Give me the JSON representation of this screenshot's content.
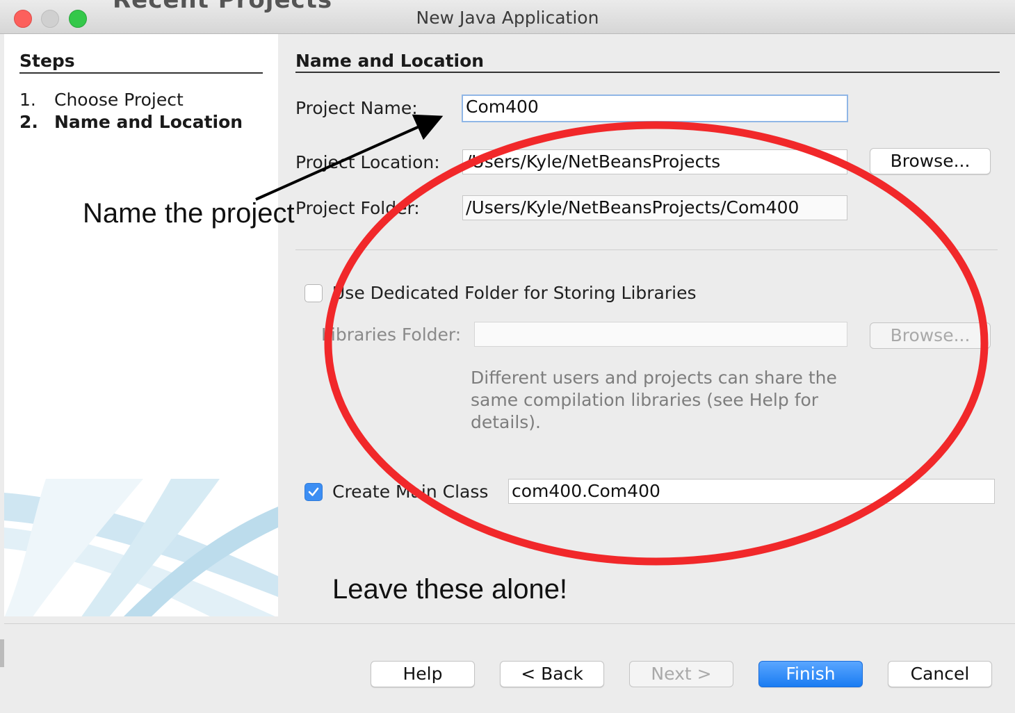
{
  "window": {
    "title": "New Java Application",
    "background_title_fragment": "Recent Projects"
  },
  "steps": {
    "title": "Steps",
    "items": [
      {
        "num": "1.",
        "label": "Choose Project"
      },
      {
        "num": "2.",
        "label": "Name and Location"
      }
    ]
  },
  "section": {
    "title": "Name and Location"
  },
  "form": {
    "project_name_label": "Project Name:",
    "project_name_value": "Com400",
    "project_location_label": "Project Location:",
    "project_location_value": "/Users/Kyle/NetBeansProjects",
    "browse_label": "Browse...",
    "project_folder_label": "Project Folder:",
    "project_folder_value": "/Users/Kyle/NetBeansProjects/Com400",
    "dedicated_folder_label": "Use Dedicated Folder for Storing Libraries",
    "dedicated_folder_checked": false,
    "libraries_folder_label": "Libraries Folder:",
    "libraries_folder_value": "",
    "libraries_browse_label": "Browse...",
    "help_text": "Different users and projects can share the same compilation libraries (see Help for details).",
    "create_main_label": "Create Main Class",
    "create_main_checked": true,
    "main_class_value": "com400.Com400"
  },
  "footer": {
    "help": "Help",
    "back": "< Back",
    "next": "Next >",
    "finish": "Finish",
    "cancel": "Cancel"
  },
  "annotations": {
    "name_project": "Name the project",
    "leave_alone": "Leave these alone!"
  },
  "colors": {
    "accent": "#1a7cf2",
    "annotation_red": "#f1282a",
    "close": "#fc605c",
    "maximize": "#34c84a"
  }
}
